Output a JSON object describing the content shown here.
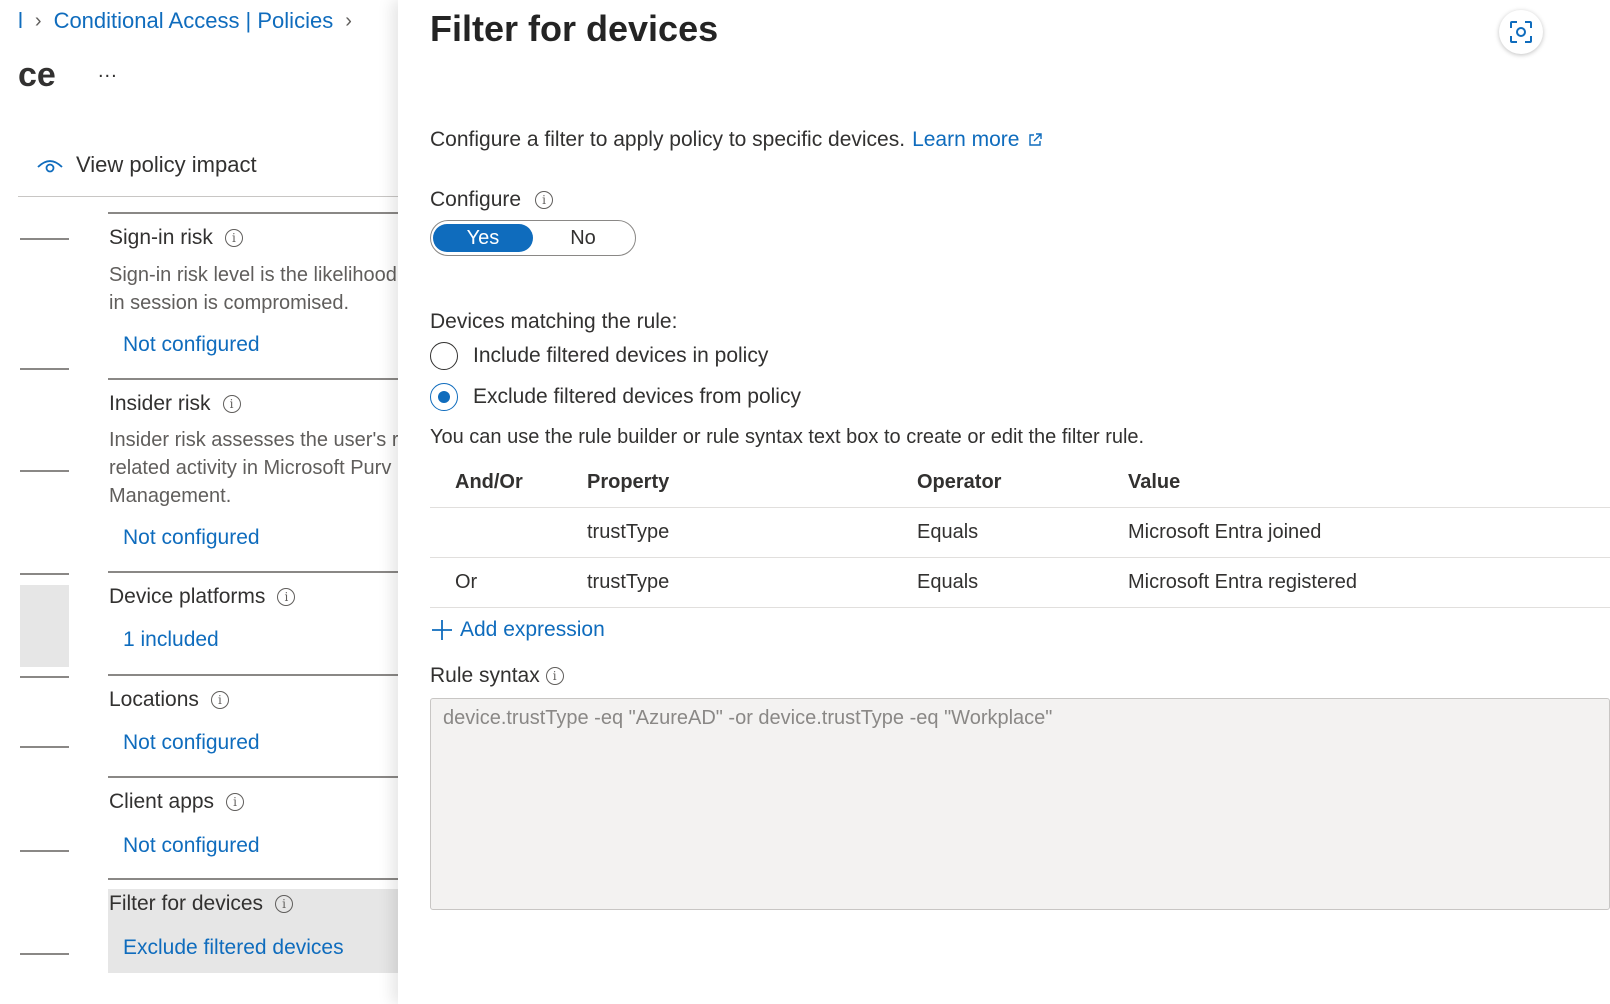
{
  "breadcrumb": {
    "partial_prefix": "l",
    "policies_link": "Conditional Access | Policies"
  },
  "left": {
    "title": "ce",
    "more": "...",
    "view_policy_impact": "View policy impact",
    "sections": {
      "sign_in_risk": {
        "title": "Sign-in risk",
        "desc_line1": "Sign-in risk level is the likelihood",
        "desc_line2": "in session is compromised.",
        "value": "Not configured"
      },
      "insider_risk": {
        "title": "Insider risk",
        "desc_line1": "Insider risk assesses the user's ri",
        "desc_line2": "related activity in Microsoft Purv",
        "desc_line3": "Management.",
        "value": "Not configured"
      },
      "device_platforms": {
        "title": "Device platforms",
        "value": "1 included"
      },
      "locations": {
        "title": "Locations",
        "value": "Not configured"
      },
      "client_apps": {
        "title": "Client apps",
        "value": "Not configured"
      },
      "filter_for_devices": {
        "title": "Filter for devices",
        "value": "Exclude filtered devices"
      }
    }
  },
  "panel": {
    "title": "Filter for devices",
    "description": "Configure a filter to apply policy to specific devices.",
    "learn_more": "Learn more",
    "configure": {
      "label": "Configure",
      "yes": "Yes",
      "no": "No",
      "selected": "Yes"
    },
    "matching": {
      "label": "Devices matching the rule:",
      "include": "Include filtered devices in policy",
      "exclude": "Exclude filtered devices from policy",
      "selected": "exclude"
    },
    "help_text": "You can use the rule builder or rule syntax text box to create or edit the filter rule.",
    "table": {
      "headers": {
        "and_or": "And/Or",
        "property": "Property",
        "operator": "Operator",
        "value": "Value"
      },
      "rows": [
        {
          "and_or": "",
          "property": "trustType",
          "operator": "Equals",
          "value": "Microsoft Entra joined"
        },
        {
          "and_or": "Or",
          "property": "trustType",
          "operator": "Equals",
          "value": "Microsoft Entra registered"
        }
      ]
    },
    "add_expression": "Add expression",
    "rule_syntax": {
      "label": "Rule syntax",
      "value": "device.trustType -eq \"AzureAD\" -or device.trustType -eq \"Workplace\""
    }
  },
  "colors": {
    "accent": "#0f6cbd",
    "text": "#323130",
    "muted": "#605e5c",
    "selected_bg": "#e6e6e6"
  }
}
